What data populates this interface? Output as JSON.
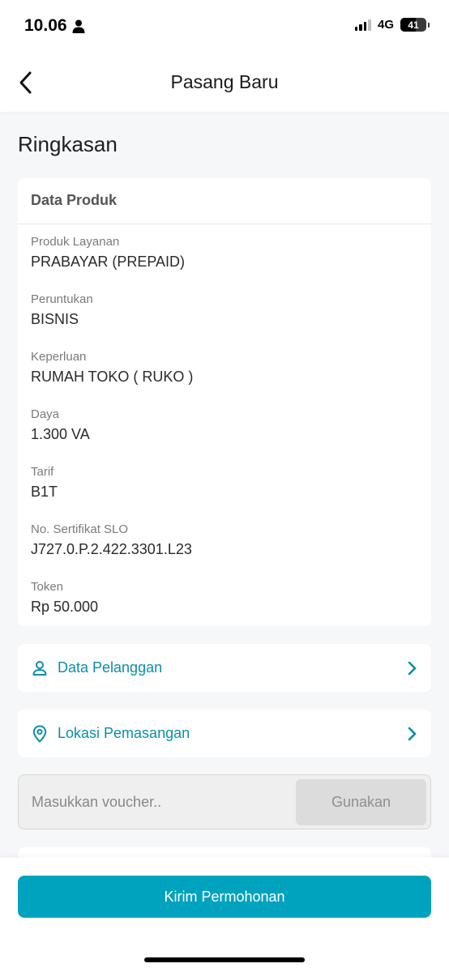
{
  "status_bar": {
    "time": "10.06",
    "network": "4G",
    "battery": "41"
  },
  "header": {
    "title": "Pasang Baru"
  },
  "summary": {
    "title": "Ringkasan",
    "card_title": "Data Produk",
    "fields": [
      {
        "label": "Produk Layanan",
        "value": "PRABAYAR (PREPAID)"
      },
      {
        "label": "Peruntukan",
        "value": "BISNIS"
      },
      {
        "label": "Keperluan",
        "value": "RUMAH TOKO ( RUKO )"
      },
      {
        "label": "Daya",
        "value": "1.300 VA"
      },
      {
        "label": "Tarif",
        "value": "B1T"
      },
      {
        "label": "No. Sertifikat SLO",
        "value": "J727.0.P.2.422.3301.L23"
      },
      {
        "label": "Token",
        "value": "Rp 50.000"
      }
    ]
  },
  "links": {
    "customer": {
      "label": "Data Pelanggan",
      "icon": "person-icon"
    },
    "location": {
      "label": "Lokasi Pemasangan",
      "icon": "location-pin-icon"
    }
  },
  "voucher": {
    "placeholder": "Masukkan voucher..",
    "value": "",
    "apply_label": "Gunakan"
  },
  "footer": {
    "submit_label": "Kirim Permohonan"
  },
  "colors": {
    "accent": "#00a3bd",
    "link": "#0a8fa8"
  }
}
